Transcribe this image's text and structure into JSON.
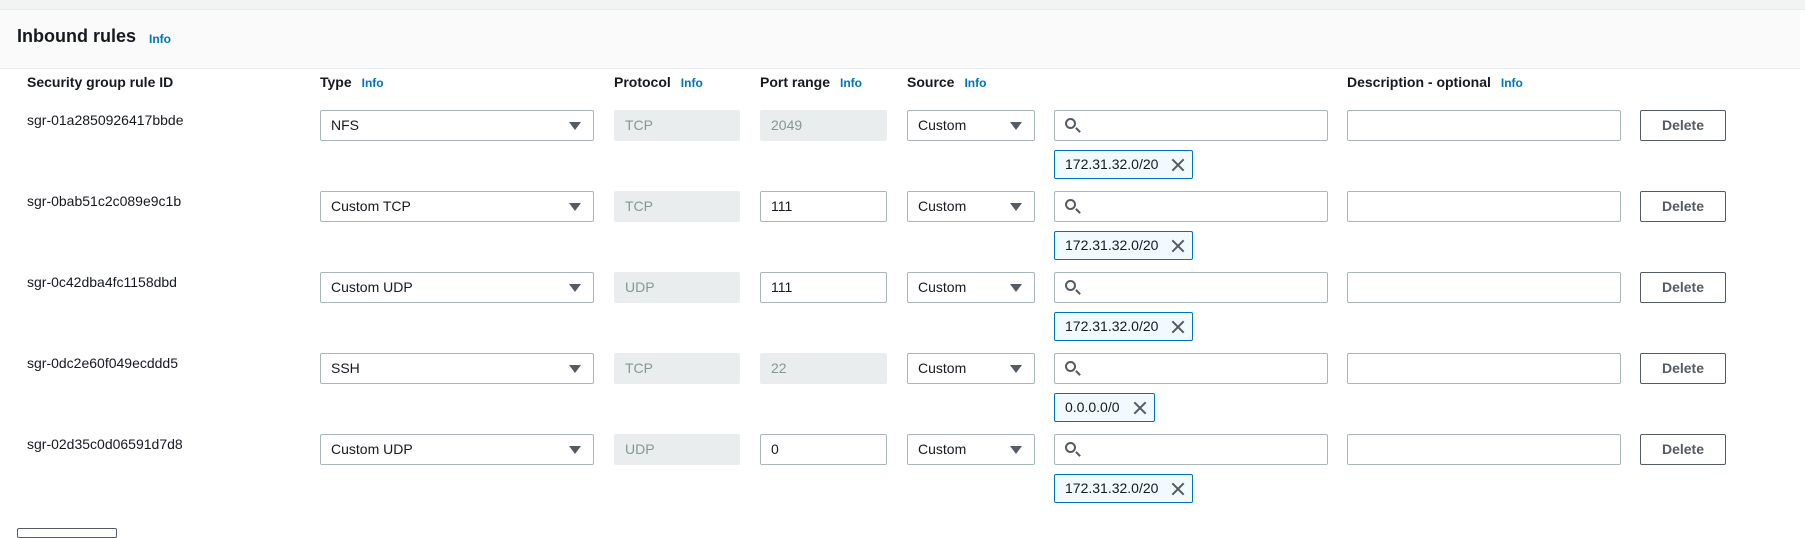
{
  "panel": {
    "title": "Inbound rules",
    "info": "Info"
  },
  "columns": {
    "rule_id": "Security group rule ID",
    "type": "Type",
    "protocol": "Protocol",
    "port_range": "Port range",
    "source": "Source",
    "description": "Description - optional",
    "info": "Info"
  },
  "rules": [
    {
      "id": "sgr-01a2850926417bbde",
      "type": "NFS",
      "protocol": "TCP",
      "port": "2049",
      "port_editable": false,
      "source": "Custom",
      "search_value": "",
      "cidr": "172.31.32.0/20",
      "description": "",
      "delete": "Delete"
    },
    {
      "id": "sgr-0bab51c2c089e9c1b",
      "type": "Custom TCP",
      "protocol": "TCP",
      "port": "111",
      "port_editable": true,
      "source": "Custom",
      "search_value": "",
      "cidr": "172.31.32.0/20",
      "description": "",
      "delete": "Delete"
    },
    {
      "id": "sgr-0c42dba4fc1158dbd",
      "type": "Custom UDP",
      "protocol": "UDP",
      "port": "111",
      "port_editable": true,
      "source": "Custom",
      "search_value": "",
      "cidr": "172.31.32.0/20",
      "description": "",
      "delete": "Delete"
    },
    {
      "id": "sgr-0dc2e60f049ecddd5",
      "type": "SSH",
      "protocol": "TCP",
      "port": "22",
      "port_editable": false,
      "source": "Custom",
      "search_value": "",
      "cidr": "0.0.0.0/0",
      "description": "",
      "delete": "Delete"
    },
    {
      "id": "sgr-02d35c0d06591d7d8",
      "type": "Custom UDP",
      "protocol": "UDP",
      "port": "0",
      "port_editable": true,
      "source": "Custom",
      "search_value": "",
      "cidr": "172.31.32.0/20",
      "description": "",
      "delete": "Delete"
    }
  ],
  "colors": {
    "link": "#0073bb",
    "token_border": "#0073bb",
    "token_bg": "#f1faff",
    "disabled_bg": "#eaeded"
  },
  "icons": {
    "dropdown": "caret-down-icon",
    "search": "search-icon",
    "remove": "close-icon"
  }
}
